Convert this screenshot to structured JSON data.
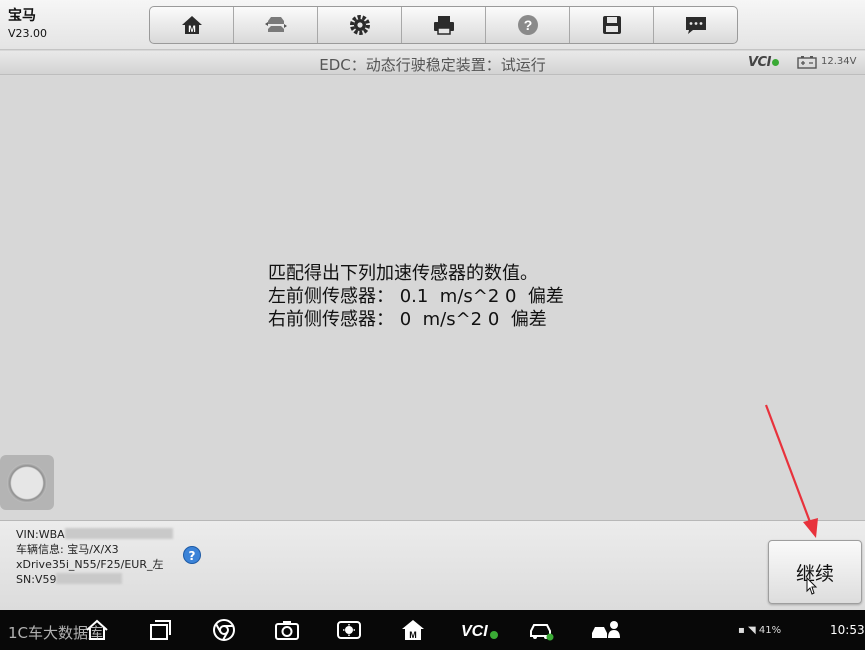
{
  "header": {
    "brand": "宝马",
    "version": "V23.00",
    "toolbar": [
      {
        "icon": "home-icon"
      },
      {
        "icon": "vehicle-swap-icon"
      },
      {
        "icon": "gear-icon"
      },
      {
        "icon": "printer-icon"
      },
      {
        "icon": "help-icon"
      },
      {
        "icon": "save-icon"
      },
      {
        "icon": "message-icon"
      }
    ]
  },
  "titlebar": {
    "title": "EDC：动态行驶稳定装置：试运行",
    "vci": "VCI",
    "voltage": "12.34V"
  },
  "main": {
    "lines": [
      "匹配得出下列加速传感器的数值。",
      "左前侧传感器： 0.1  m/s^2 0  偏差",
      "右前侧传感器： 0  m/s^2 0  偏差"
    ]
  },
  "vehicle": {
    "vin_label": "VIN:WBA",
    "info": "车辆信息: 宝马/X/X3",
    "model": "xDrive35i_N55/F25/EUR_左",
    "sn_label": "SN:V59"
  },
  "actions": {
    "continue": "继续"
  },
  "navbar": {
    "watermark": "1C车大数据库",
    "battery": "41%",
    "time": "10:53"
  },
  "colors": {
    "accent_green": "#3aaa35",
    "help_blue": "#3b83d8",
    "annotation_red": "#e8323c"
  }
}
